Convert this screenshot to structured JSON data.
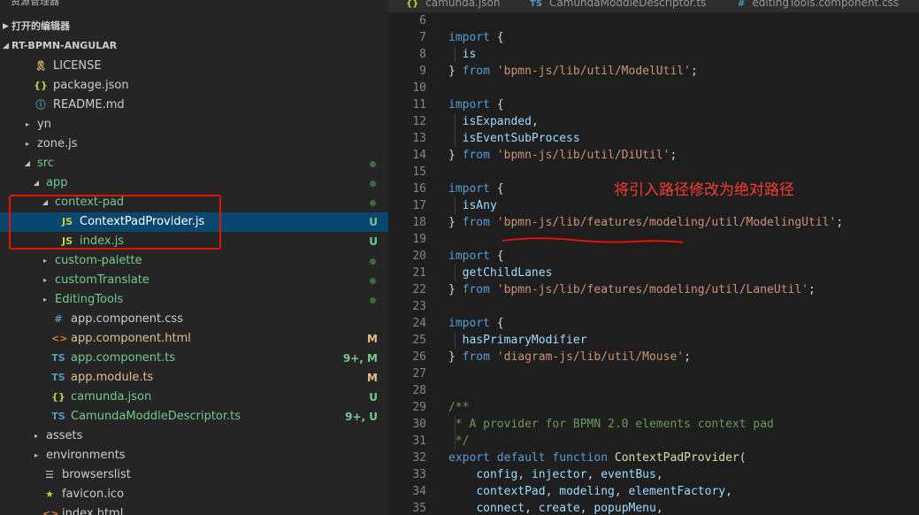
{
  "sidebar": {
    "title": "资源管理器",
    "open_editors": "打开的编辑器",
    "project": "RT-BPMN-ANGULAR",
    "tree": [
      {
        "label": "LICENSE",
        "depth": 1,
        "twisty": "",
        "icon": "user-icon",
        "glyph": "🎗",
        "icon_color": "#e8c26a",
        "label_color": "#cccccc",
        "dot": false,
        "badge": ""
      },
      {
        "label": "package.json",
        "depth": 1,
        "twisty": "",
        "icon": "json-icon",
        "glyph": "{}",
        "icon_color": "#cbcb41",
        "label_color": "#cccccc",
        "dot": false,
        "badge": ""
      },
      {
        "label": "README.md",
        "depth": 1,
        "twisty": "",
        "icon": "info-icon",
        "glyph": "ⓘ",
        "icon_color": "#519aba",
        "label_color": "#cccccc",
        "dot": false,
        "badge": ""
      },
      {
        "label": "yn",
        "depth": 1,
        "twisty": "▸",
        "icon": "",
        "glyph": "",
        "icon_color": "",
        "label_color": "#cccccc",
        "dot": false,
        "badge": ""
      },
      {
        "label": "zone.js",
        "depth": 1,
        "twisty": "▸",
        "icon": "",
        "glyph": "",
        "icon_color": "",
        "label_color": "#cccccc",
        "dot": false,
        "badge": ""
      },
      {
        "label": "src",
        "depth": 1,
        "twisty": "◢",
        "icon": "",
        "glyph": "",
        "icon_color": "",
        "label_color": "#73c991",
        "dot": true,
        "badge": ""
      },
      {
        "label": "app",
        "depth": 2,
        "twisty": "◢",
        "icon": "",
        "glyph": "",
        "icon_color": "",
        "label_color": "#73c991",
        "dot": true,
        "badge": ""
      },
      {
        "label": "context-pad",
        "depth": 3,
        "twisty": "◢",
        "icon": "",
        "glyph": "",
        "icon_color": "",
        "label_color": "#73c991",
        "dot": true,
        "badge": ""
      },
      {
        "label": "ContextPadProvider.js",
        "depth": 4,
        "twisty": "",
        "icon": "js-icon",
        "glyph": "JS",
        "icon_color": "#cbcb41",
        "label_color": "#ffffff",
        "dot": false,
        "badge": "U",
        "badge_color": "#73c991",
        "selected": true
      },
      {
        "label": "index.js",
        "depth": 4,
        "twisty": "",
        "icon": "js-icon",
        "glyph": "JS",
        "icon_color": "#cbcb41",
        "label_color": "#73c991",
        "dot": false,
        "badge": "U",
        "badge_color": "#73c991"
      },
      {
        "label": "custom-palette",
        "depth": 3,
        "twisty": "▸",
        "icon": "",
        "glyph": "",
        "icon_color": "",
        "label_color": "#73c991",
        "dot": true,
        "badge": ""
      },
      {
        "label": "customTranslate",
        "depth": 3,
        "twisty": "▸",
        "icon": "",
        "glyph": "",
        "icon_color": "",
        "label_color": "#73c991",
        "dot": true,
        "badge": ""
      },
      {
        "label": "EditingTools",
        "depth": 3,
        "twisty": "▸",
        "icon": "",
        "glyph": "",
        "icon_color": "",
        "label_color": "#73c991",
        "dot": true,
        "badge": ""
      },
      {
        "label": "app.component.css",
        "depth": 3,
        "twisty": "",
        "icon": "css-icon",
        "glyph": "#",
        "icon_color": "#519aba",
        "label_color": "#cccccc",
        "dot": false,
        "badge": ""
      },
      {
        "label": "app.component.html",
        "depth": 3,
        "twisty": "",
        "icon": "html-icon",
        "glyph": "<>",
        "icon_color": "#e37933",
        "label_color": "#e2c08d",
        "dot": false,
        "badge": "M",
        "badge_color": "#e2c08d"
      },
      {
        "label": "app.component.ts",
        "depth": 3,
        "twisty": "",
        "icon": "ts-icon",
        "glyph": "TS",
        "icon_color": "#519aba",
        "label_color": "#73c991",
        "dot": false,
        "badge": "9+, M",
        "badge_color": "#73c991"
      },
      {
        "label": "app.module.ts",
        "depth": 3,
        "twisty": "",
        "icon": "ts-icon",
        "glyph": "TS",
        "icon_color": "#519aba",
        "label_color": "#e2c08d",
        "dot": false,
        "badge": "M",
        "badge_color": "#e2c08d"
      },
      {
        "label": "camunda.json",
        "depth": 3,
        "twisty": "",
        "icon": "json-icon",
        "glyph": "{}",
        "icon_color": "#cbcb41",
        "label_color": "#73c991",
        "dot": false,
        "badge": "U",
        "badge_color": "#73c991"
      },
      {
        "label": "CamundaModdleDescriptor.ts",
        "depth": 3,
        "twisty": "",
        "icon": "ts-icon",
        "glyph": "TS",
        "icon_color": "#519aba",
        "label_color": "#73c991",
        "dot": false,
        "badge": "9+, U",
        "badge_color": "#73c991"
      },
      {
        "label": "assets",
        "depth": 2,
        "twisty": "▸",
        "icon": "",
        "glyph": "",
        "icon_color": "",
        "label_color": "#cccccc",
        "dot": false,
        "badge": ""
      },
      {
        "label": "environments",
        "depth": 2,
        "twisty": "▸",
        "icon": "",
        "glyph": "",
        "icon_color": "",
        "label_color": "#cccccc",
        "dot": false,
        "badge": ""
      },
      {
        "label": "browserslist",
        "depth": 2,
        "twisty": "",
        "icon": "list-icon",
        "glyph": "☰",
        "icon_color": "#cccccc",
        "label_color": "#cccccc",
        "dot": false,
        "badge": ""
      },
      {
        "label": "favicon.ico",
        "depth": 2,
        "twisty": "",
        "icon": "star-icon",
        "glyph": "★",
        "icon_color": "#cbcb41",
        "label_color": "#cccccc",
        "dot": false,
        "badge": ""
      },
      {
        "label": "index.html",
        "depth": 2,
        "twisty": "",
        "icon": "html-icon",
        "glyph": "<>",
        "icon_color": "#e37933",
        "label_color": "#cccccc",
        "dot": false,
        "badge": ""
      }
    ]
  },
  "tabs": [
    {
      "icon": "json-icon",
      "glyph": "{}",
      "icon_color": "#cbcb41",
      "label": "camunda.json"
    },
    {
      "icon": "ts-icon",
      "glyph": "TS",
      "icon_color": "#519aba",
      "label": "CamundaModdleDescriptor.ts"
    },
    {
      "icon": "css-icon",
      "glyph": "#",
      "icon_color": "#519aba",
      "label": "editingTools.component.css"
    }
  ],
  "code_lines": [
    {
      "n": "6",
      "t": []
    },
    {
      "n": "7",
      "t": [
        [
          "kw",
          "import"
        ],
        [
          "",
          " {"
        ]
      ]
    },
    {
      "n": "8",
      "t": [
        [
          "",
          "  "
        ],
        [
          "id",
          "is"
        ]
      ]
    },
    {
      "n": "9",
      "t": [
        [
          "",
          "} "
        ],
        [
          "kw",
          "from"
        ],
        [
          "",
          " "
        ],
        [
          "str",
          "'bpmn-js/lib/util/ModelUtil'"
        ],
        [
          "",
          ";"
        ]
      ]
    },
    {
      "n": "10",
      "t": []
    },
    {
      "n": "11",
      "t": [
        [
          "kw",
          "import"
        ],
        [
          "",
          " {"
        ]
      ]
    },
    {
      "n": "12",
      "t": [
        [
          "",
          "  "
        ],
        [
          "id",
          "isExpanded"
        ],
        [
          "",
          ","
        ]
      ]
    },
    {
      "n": "13",
      "t": [
        [
          "",
          "  "
        ],
        [
          "id",
          "isEventSubProcess"
        ]
      ]
    },
    {
      "n": "14",
      "t": [
        [
          "",
          "} "
        ],
        [
          "kw",
          "from"
        ],
        [
          "",
          " "
        ],
        [
          "str",
          "'bpmn-js/lib/util/DiUtil'"
        ],
        [
          "",
          ";"
        ]
      ]
    },
    {
      "n": "15",
      "t": []
    },
    {
      "n": "16",
      "t": [
        [
          "kw",
          "import"
        ],
        [
          "",
          " {"
        ]
      ]
    },
    {
      "n": "17",
      "t": [
        [
          "",
          "  "
        ],
        [
          "id",
          "isAny"
        ]
      ]
    },
    {
      "n": "18",
      "t": [
        [
          "",
          "} "
        ],
        [
          "kw",
          "from"
        ],
        [
          "",
          " "
        ],
        [
          "str",
          "'bpmn-js/lib/features/modeling/util/ModelingUtil'"
        ],
        [
          "",
          ";"
        ]
      ]
    },
    {
      "n": "19",
      "t": []
    },
    {
      "n": "20",
      "t": [
        [
          "kw",
          "import"
        ],
        [
          "",
          " {"
        ]
      ]
    },
    {
      "n": "21",
      "t": [
        [
          "",
          "  "
        ],
        [
          "id",
          "getChildLanes"
        ]
      ]
    },
    {
      "n": "22",
      "t": [
        [
          "",
          "} "
        ],
        [
          "kw",
          "from"
        ],
        [
          "",
          " "
        ],
        [
          "str",
          "'bpmn-js/lib/features/modeling/util/LaneUtil'"
        ],
        [
          "",
          ";"
        ]
      ]
    },
    {
      "n": "23",
      "t": []
    },
    {
      "n": "24",
      "t": [
        [
          "kw",
          "import"
        ],
        [
          "",
          " {"
        ]
      ]
    },
    {
      "n": "25",
      "t": [
        [
          "",
          "  "
        ],
        [
          "id",
          "hasPrimaryModifier"
        ]
      ]
    },
    {
      "n": "26",
      "t": [
        [
          "",
          "} "
        ],
        [
          "kw",
          "from"
        ],
        [
          "",
          " "
        ],
        [
          "str",
          "'diagram-js/lib/util/Mouse'"
        ],
        [
          "",
          ";"
        ]
      ]
    },
    {
      "n": "27",
      "t": []
    },
    {
      "n": "28",
      "t": []
    },
    {
      "n": "29",
      "t": [
        [
          "cm",
          "/**"
        ]
      ]
    },
    {
      "n": "30",
      "t": [
        [
          "cm",
          " * A provider for BPMN 2.0 elements context pad"
        ]
      ]
    },
    {
      "n": "31",
      "t": [
        [
          "cm",
          " */"
        ]
      ]
    },
    {
      "n": "32",
      "t": [
        [
          "kw",
          "export"
        ],
        [
          "",
          " "
        ],
        [
          "kw",
          "default"
        ],
        [
          "",
          " "
        ],
        [
          "kw",
          "function"
        ],
        [
          "",
          " "
        ],
        [
          "fn",
          "ContextPadProvider"
        ],
        [
          "",
          "("
        ]
      ]
    },
    {
      "n": "33",
      "t": [
        [
          "",
          "    "
        ],
        [
          "id",
          "config"
        ],
        [
          "",
          ", "
        ],
        [
          "id",
          "injector"
        ],
        [
          "",
          ", "
        ],
        [
          "id",
          "eventBus"
        ],
        [
          "",
          ","
        ]
      ]
    },
    {
      "n": "34",
      "t": [
        [
          "",
          "    "
        ],
        [
          "id",
          "contextPad"
        ],
        [
          "",
          ", "
        ],
        [
          "id",
          "modeling"
        ],
        [
          "",
          ", "
        ],
        [
          "id",
          "elementFactory"
        ],
        [
          "",
          ","
        ]
      ]
    },
    {
      "n": "35",
      "t": [
        [
          "",
          "    "
        ],
        [
          "id",
          "connect"
        ],
        [
          "",
          ", "
        ],
        [
          "id",
          "create"
        ],
        [
          "",
          ", "
        ],
        [
          "id",
          "popupMenu"
        ],
        [
          "",
          ","
        ]
      ]
    }
  ],
  "annotation": "将引入路径修改为绝对路径",
  "colors": {
    "annotation": "#ff3b30",
    "selection": "#094771",
    "box": "#e51400"
  }
}
